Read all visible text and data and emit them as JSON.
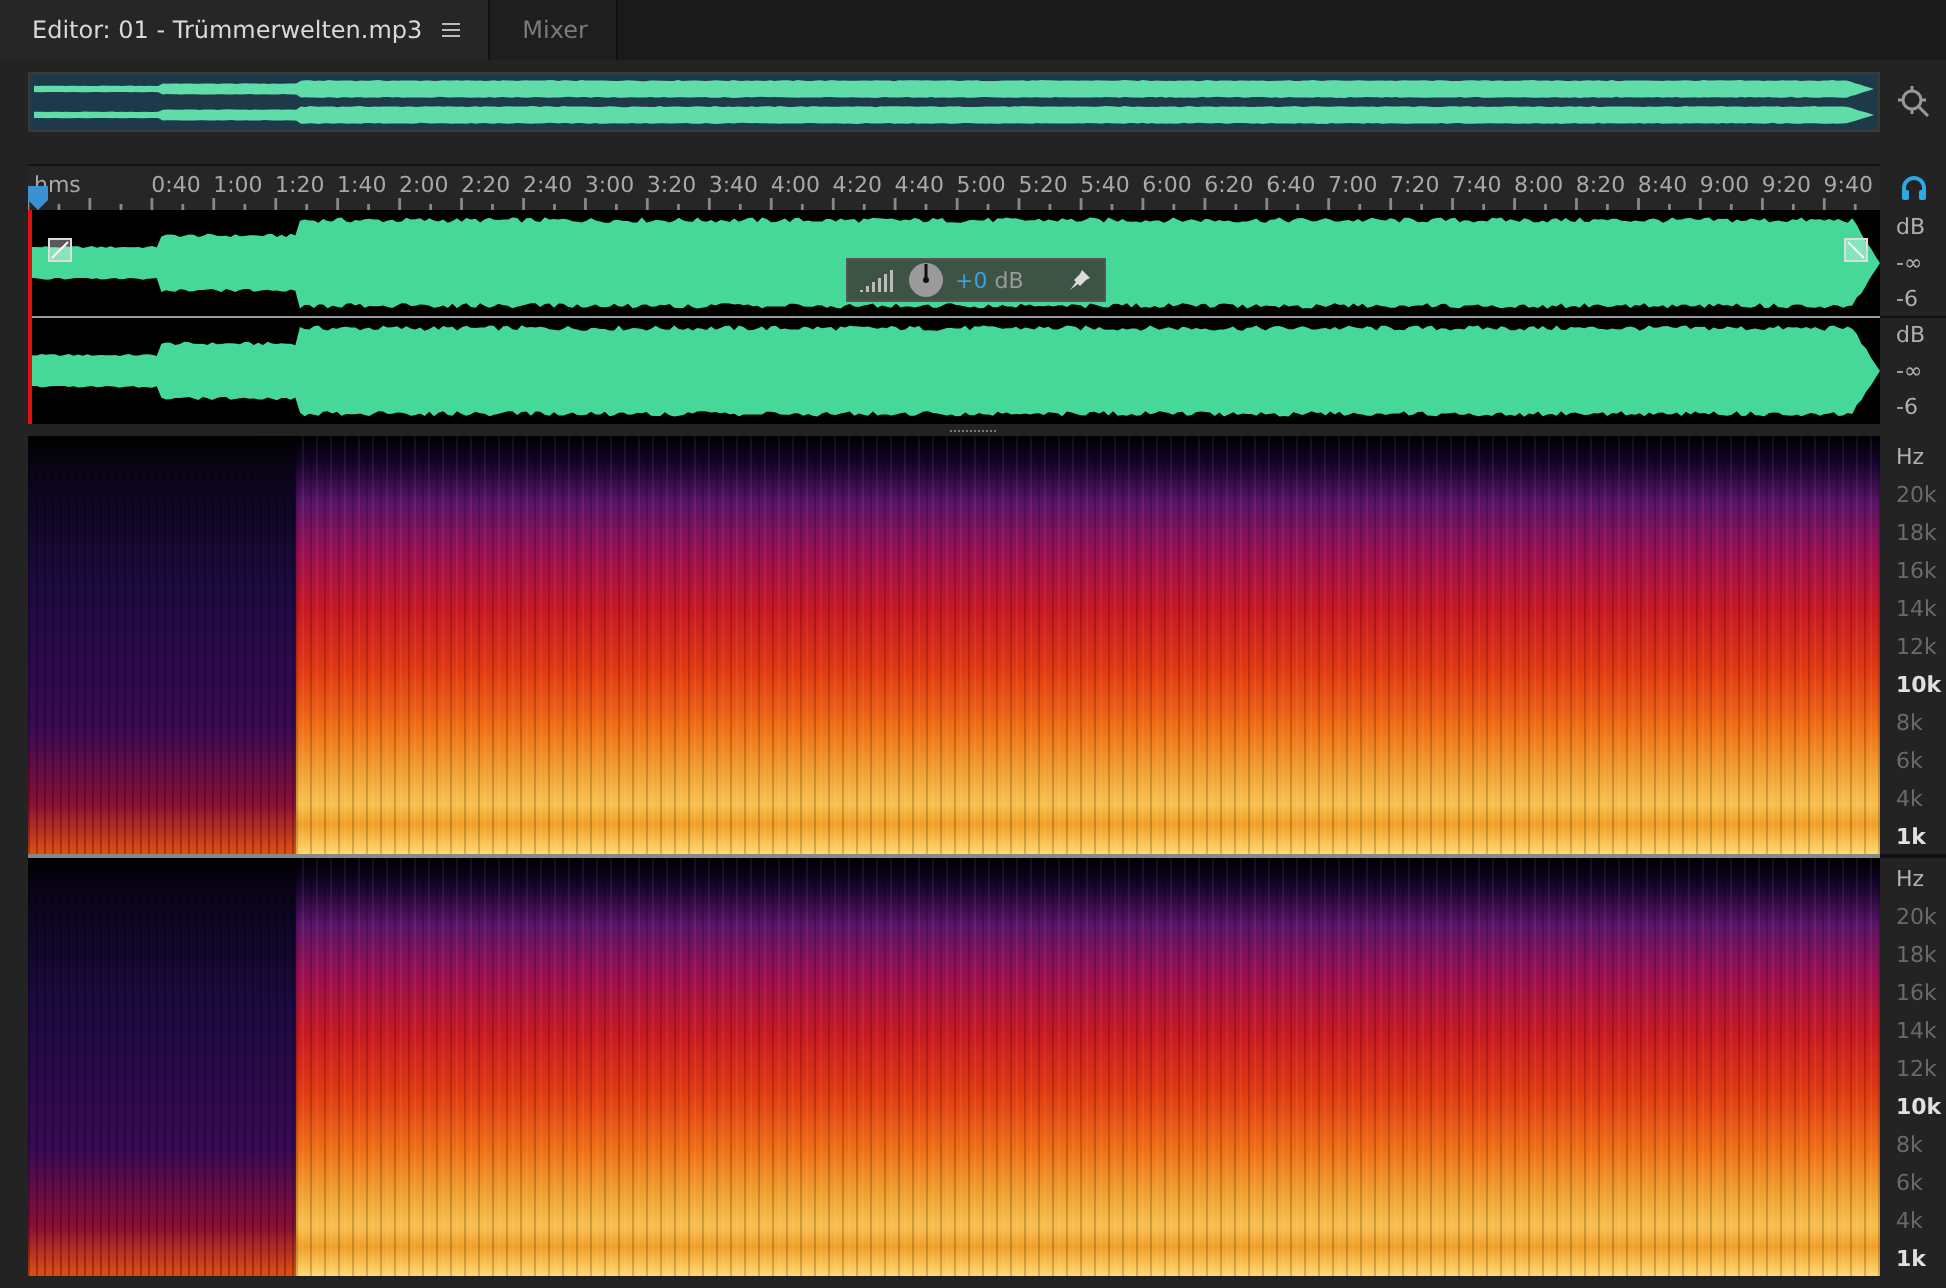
{
  "tabs": [
    {
      "label": "Editor: 01 - Trümmerwelten.mp3",
      "selected": true,
      "has_menu": true
    },
    {
      "label": "Mixer",
      "selected": false,
      "has_menu": false
    }
  ],
  "ruler": {
    "unit": "hms",
    "labels": [
      "0:40",
      "1:00",
      "1:20",
      "1:40",
      "2:00",
      "2:20",
      "2:40",
      "3:00",
      "3:20",
      "3:40",
      "4:00",
      "4:20",
      "4:40",
      "5:00",
      "5:20",
      "5:40",
      "6:00",
      "6:20",
      "6:40",
      "7:00",
      "7:20",
      "7:40",
      "8:00",
      "8:20",
      "8:40",
      "9:00",
      "9:20",
      "9:40"
    ]
  },
  "hud": {
    "value": "+0",
    "unit": "dB"
  },
  "waveform_channels": [
    {
      "scale": [
        "dB",
        "-∞",
        "-6"
      ]
    },
    {
      "scale": [
        "dB",
        "-∞",
        "-6"
      ]
    }
  ],
  "spectral_channels": [
    {
      "scale": [
        {
          "label": "Hz",
          "emphasized": false
        },
        {
          "label": "20k",
          "emphasized": false
        },
        {
          "label": "18k",
          "emphasized": false
        },
        {
          "label": "16k",
          "emphasized": false
        },
        {
          "label": "14k",
          "emphasized": false
        },
        {
          "label": "12k",
          "emphasized": false
        },
        {
          "label": "10k",
          "emphasized": true
        },
        {
          "label": "8k",
          "emphasized": false
        },
        {
          "label": "6k",
          "emphasized": false
        },
        {
          "label": "4k",
          "emphasized": false
        },
        {
          "label": "1k",
          "emphasized": true
        }
      ]
    },
    {
      "scale": [
        {
          "label": "Hz",
          "emphasized": false
        },
        {
          "label": "20k",
          "emphasized": false
        },
        {
          "label": "18k",
          "emphasized": false
        },
        {
          "label": "16k",
          "emphasized": false
        },
        {
          "label": "14k",
          "emphasized": false
        },
        {
          "label": "12k",
          "emphasized": false
        },
        {
          "label": "10k",
          "emphasized": true
        },
        {
          "label": "8k",
          "emphasized": false
        },
        {
          "label": "6k",
          "emphasized": false
        },
        {
          "label": "4k",
          "emphasized": false
        },
        {
          "label": "1k",
          "emphasized": true
        }
      ]
    }
  ]
}
